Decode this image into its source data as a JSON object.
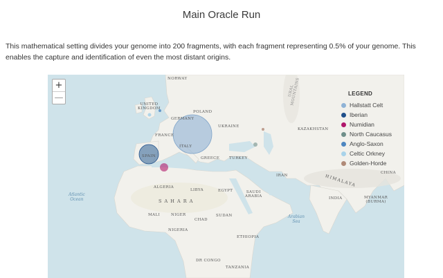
{
  "page": {
    "title": "Main Oracle Run",
    "description": "This mathematical setting divides your genome into 200 fragments, with each fragment representing 0.5% of your genome. This enables the capture and identification of even the most distant origins."
  },
  "map": {
    "zoom_in": "+",
    "zoom_out": "—",
    "labels": {
      "norway": "NORWAY",
      "united_kingdom": "UNITED\nKINGDOM",
      "poland": "POLAND",
      "germany": "GERMANY",
      "france": "FRANCE",
      "italy": "ITALY",
      "ukraine": "UKRAINE",
      "kazakhstan": "KAZAKHSTAN",
      "spain": "SPAIN",
      "greece": "GREECE",
      "turkey": "TURKEY",
      "algeria": "ALGERIA",
      "libya": "LIBYA",
      "egypt": "EGYPT",
      "saudi_arabia": "SAUDI\nARABIA",
      "iran": "IRAN",
      "india": "INDIA",
      "china": "CHINA",
      "mali": "MALI",
      "niger": "NIGER",
      "chad": "CHAD",
      "sudan": "SUDAN",
      "nigeria": "NIGERIA",
      "ethiopia": "ETHIOPIA",
      "dr_congo": "DR CONGO",
      "tanzania": "TANZANIA",
      "myanmar": "MYANMAR\n(BURMA)",
      "sahara": "S A H A R A",
      "himalaya": "HIMALAYA",
      "ural": "URAL\nMOUNTAINS",
      "atlantic": "Atlantic\nOcean",
      "arabian_sea": "Arabian\nSea"
    },
    "colors": {
      "land": "#f2f1ec",
      "water": "#cfe3ea"
    }
  },
  "legend": {
    "title": "LEGEND",
    "items": [
      {
        "label": "Hallstatt Celt",
        "color": "#8fb3d6"
      },
      {
        "label": "Iberian",
        "color": "#1f4f8a"
      },
      {
        "label": "Numidian",
        "color": "#b0176b"
      },
      {
        "label": "North Caucasus",
        "color": "#6f8f8a"
      },
      {
        "label": "Anglo-Saxon",
        "color": "#4d86c0"
      },
      {
        "label": "Celtic Orkney",
        "color": "#a9d3ea"
      },
      {
        "label": "Golden-Horde",
        "color": "#b08a78"
      }
    ]
  }
}
